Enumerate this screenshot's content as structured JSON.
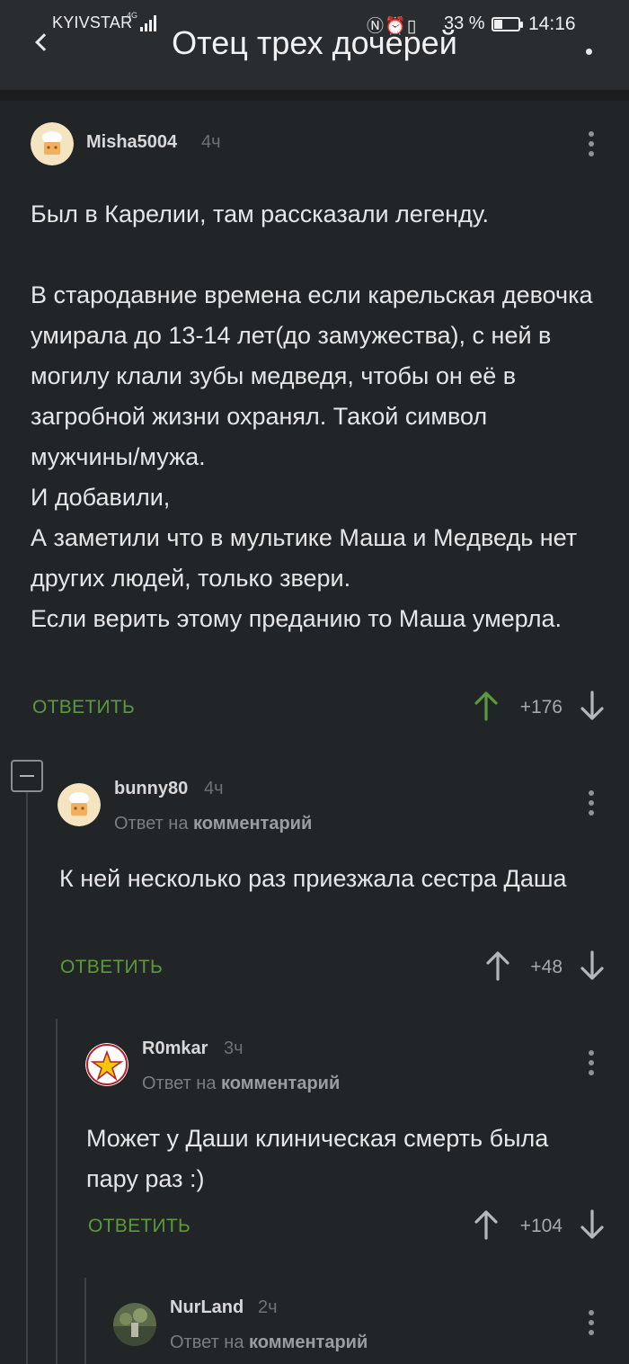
{
  "status_bar": {
    "carrier": "KYIVSTAR",
    "network": "4G",
    "battery_percent_label": "33 %",
    "battery_level": 0.33,
    "time": "14:16",
    "icons": [
      "nfc-icon",
      "alarm-icon",
      "vibrate-icon",
      "battery-icon"
    ]
  },
  "header": {
    "title": "Отец трех дочерей"
  },
  "colors": {
    "accent_green": "#5b9a3c",
    "background": "#222528"
  },
  "comments": [
    {
      "username": "Misha5004",
      "time": "4ч",
      "paragraphs": [
        "Был в Карелии, там рассказали легенду.",
        "",
        "В стародавние времена если карельская девочка умирала до 13-14 лет(до замужества), с ней в могилу клали зубы медведя, чтобы он её в загробной жизни охранял. Такой символ мужчины/мужа.",
        "И добавили,",
        "А заметили что в мультике Маша и Медведь нет других людей, только звери.",
        "Если верить этому преданию то Маша умерла."
      ],
      "reply_label": "ОТВЕТИТЬ",
      "score": "+176",
      "voted_up": true
    },
    {
      "username": "bunny80",
      "time": "4ч",
      "reply_prefix": "Ответ на",
      "reply_target": "комментарий",
      "text": "К ней несколько раз приезжала сестра Даша",
      "reply_label": "ОТВЕТИТЬ",
      "score": "+48"
    },
    {
      "username": "R0mkar",
      "time": "3ч",
      "reply_prefix": "Ответ на",
      "reply_target": "комментарий",
      "text": "Может у Даши клиническая смерть была пару раз :)",
      "reply_label": "ОТВЕТИТЬ",
      "score": "+104"
    },
    {
      "username": "NurLand",
      "time": "2ч",
      "reply_prefix": "Ответ на",
      "reply_target": "комментарий"
    }
  ]
}
